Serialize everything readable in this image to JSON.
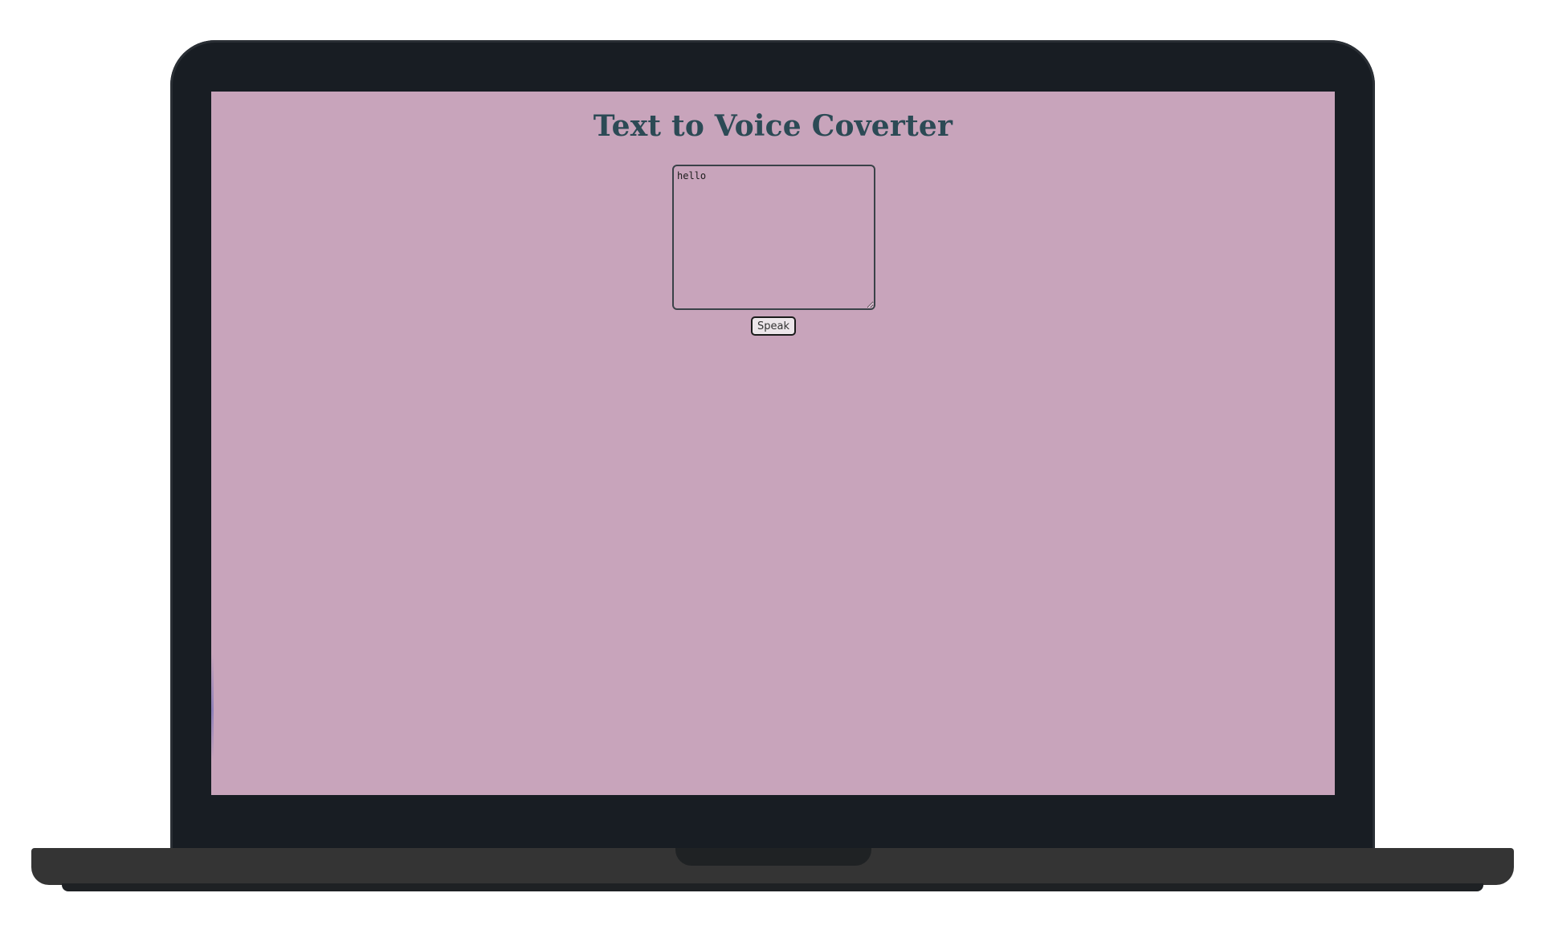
{
  "app": {
    "title": "Text to Voice Coverter"
  },
  "input": {
    "value": "hello",
    "placeholder": ""
  },
  "actions": {
    "speak_label": "Speak"
  },
  "colors": {
    "screen_background": "#c8a4bb",
    "title_color": "#2c4a55",
    "laptop_frame": "#181d23",
    "laptop_base": "#343434"
  }
}
